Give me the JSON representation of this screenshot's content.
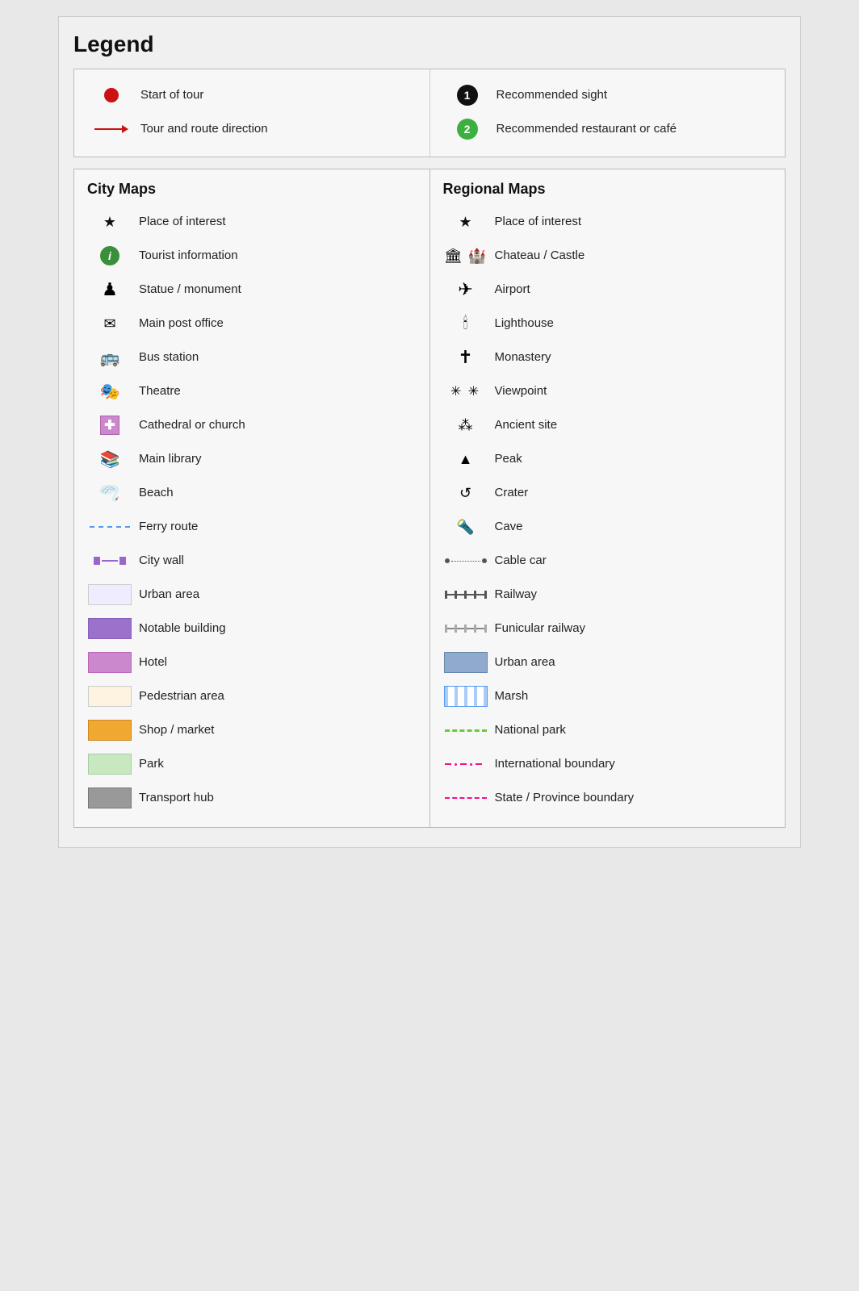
{
  "title": "Legend",
  "top": {
    "left": [
      {
        "icon": "red-dot",
        "label": "Start of tour"
      },
      {
        "icon": "red-arrow",
        "label": "Tour and route direction"
      }
    ],
    "right": [
      {
        "icon": "num-1-black",
        "label": "Recommended sight"
      },
      {
        "icon": "num-2-green",
        "label": "Recommended restaurant or café"
      }
    ]
  },
  "cityMaps": {
    "title": "City Maps",
    "items": [
      {
        "icon": "star",
        "label": "Place of interest"
      },
      {
        "icon": "info-circle",
        "label": "Tourist information"
      },
      {
        "icon": "chess-pawn",
        "label": "Statue / monument"
      },
      {
        "icon": "envelope",
        "label": "Main post office"
      },
      {
        "icon": "bus",
        "label": "Bus station"
      },
      {
        "icon": "theatre-mask",
        "label": "Theatre"
      },
      {
        "icon": "church-cross",
        "label": "Cathedral or church"
      },
      {
        "icon": "library",
        "label": "Main library"
      },
      {
        "icon": "beach",
        "label": "Beach"
      },
      {
        "icon": "ferry",
        "label": "Ferry route"
      },
      {
        "icon": "city-wall",
        "label": "City wall"
      },
      {
        "icon": "block-urban",
        "label": "Urban area"
      },
      {
        "icon": "block-notable",
        "label": "Notable building"
      },
      {
        "icon": "block-hotel",
        "label": "Hotel"
      },
      {
        "icon": "block-pedestrian",
        "label": "Pedestrian area"
      },
      {
        "icon": "block-shop",
        "label": "Shop / market"
      },
      {
        "icon": "block-park",
        "label": "Park"
      },
      {
        "icon": "block-transport",
        "label": "Transport hub"
      }
    ]
  },
  "regionalMaps": {
    "title": "Regional Maps",
    "items": [
      {
        "icon": "star-regional",
        "label": "Place of interest"
      },
      {
        "icon": "chateau",
        "label": "Chateau / Castle"
      },
      {
        "icon": "airport",
        "label": "Airport"
      },
      {
        "icon": "lighthouse",
        "label": "Lighthouse"
      },
      {
        "icon": "monastery",
        "label": "Monastery"
      },
      {
        "icon": "viewpoint",
        "label": "Viewpoint"
      },
      {
        "icon": "ancient",
        "label": "Ancient site"
      },
      {
        "icon": "peak",
        "label": "Peak"
      },
      {
        "icon": "crater",
        "label": "Crater"
      },
      {
        "icon": "cave",
        "label": "Cave"
      },
      {
        "icon": "cable-car",
        "label": "Cable car"
      },
      {
        "icon": "railway",
        "label": "Railway"
      },
      {
        "icon": "funicular",
        "label": "Funicular railway"
      },
      {
        "icon": "block-urban-regional",
        "label": "Urban area"
      },
      {
        "icon": "block-marsh",
        "label": "Marsh"
      },
      {
        "icon": "national-park",
        "label": "National park"
      },
      {
        "icon": "intl-boundary",
        "label": "International boundary"
      },
      {
        "icon": "state-boundary",
        "label": "State / Province boundary"
      }
    ]
  }
}
